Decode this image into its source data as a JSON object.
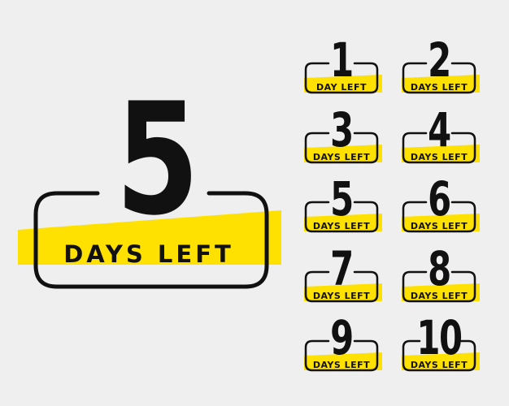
{
  "colors": {
    "background": "#efefef",
    "accent": "#ffe100",
    "ink": "#111111"
  },
  "featured": {
    "number": "5",
    "label": "DAYS LEFT"
  },
  "badges": [
    {
      "number": "1",
      "label": "DAY LEFT"
    },
    {
      "number": "2",
      "label": "DAYS LEFT"
    },
    {
      "number": "3",
      "label": "DAYS LEFT"
    },
    {
      "number": "4",
      "label": "DAYS LEFT"
    },
    {
      "number": "5",
      "label": "DAYS LEFT"
    },
    {
      "number": "6",
      "label": "DAYS LEFT"
    },
    {
      "number": "7",
      "label": "DAYS LEFT"
    },
    {
      "number": "8",
      "label": "DAYS LEFT"
    },
    {
      "number": "9",
      "label": "DAYS LEFT"
    },
    {
      "number": "10",
      "label": "DAYS LEFT"
    }
  ]
}
